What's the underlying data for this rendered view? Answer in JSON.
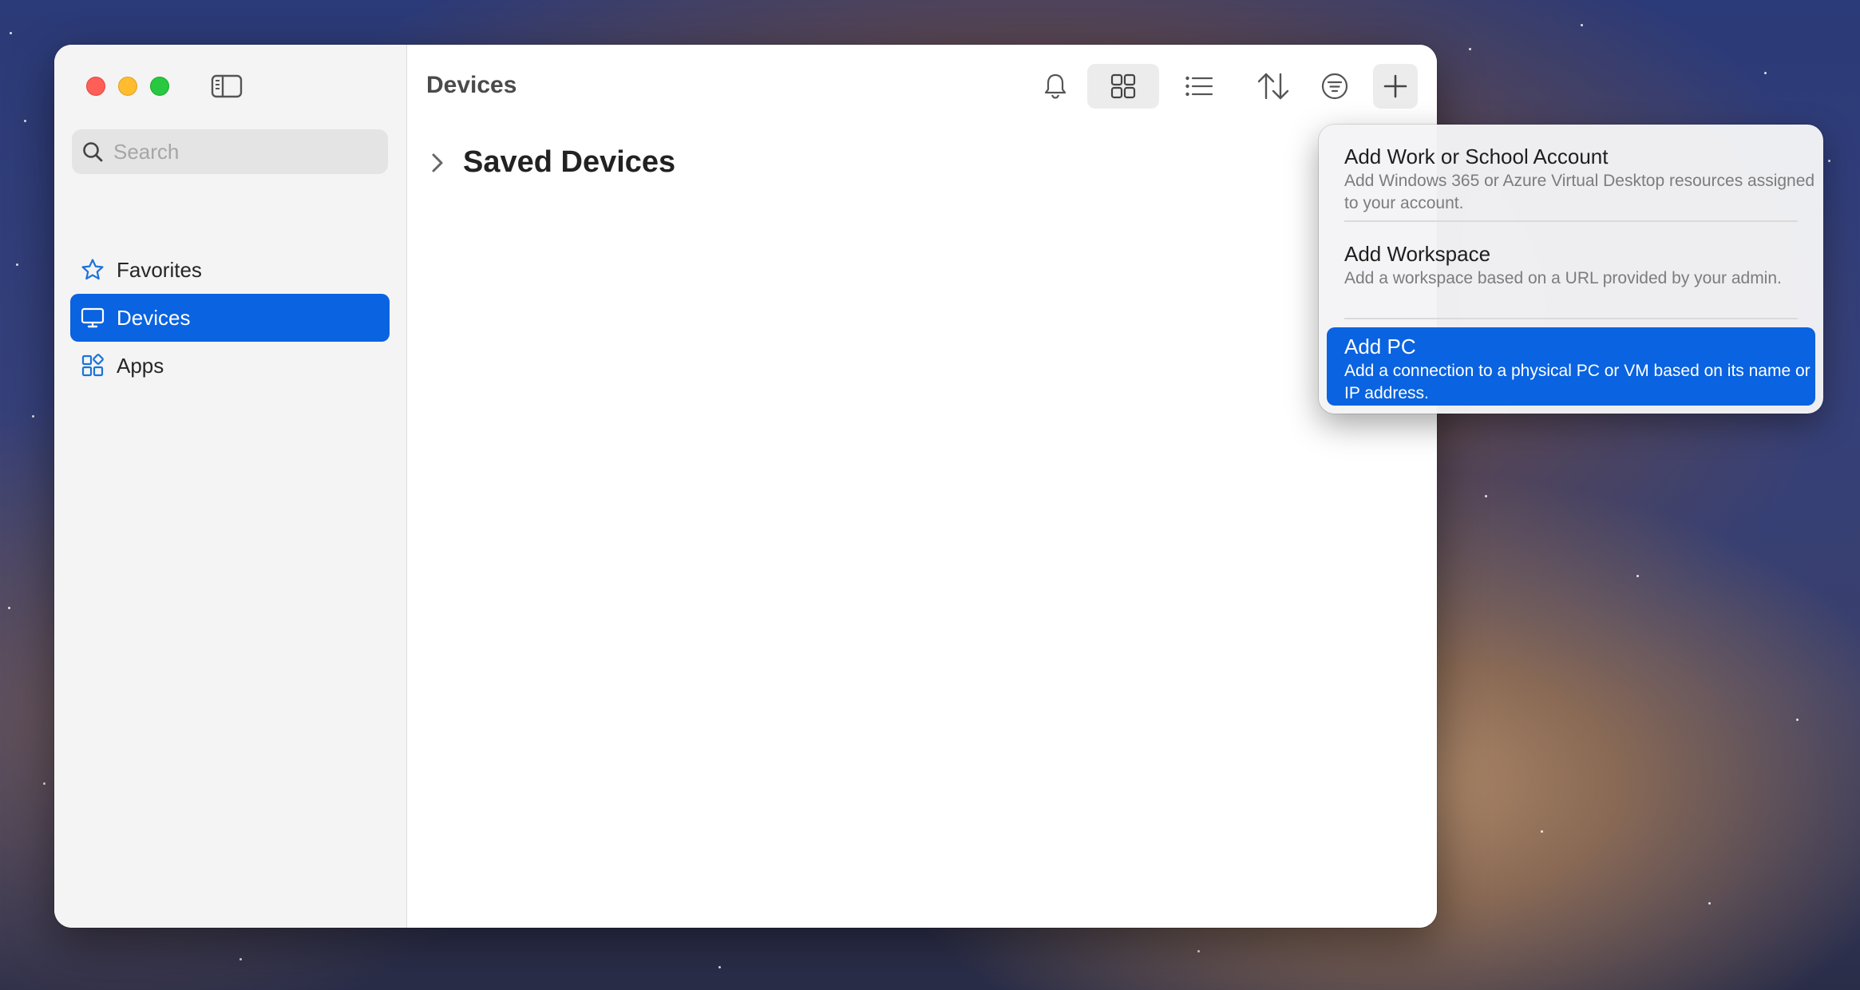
{
  "window": {
    "title": "Devices"
  },
  "sidebar": {
    "search": {
      "placeholder": "Search",
      "value": ""
    },
    "items": [
      {
        "label": "Favorites",
        "icon": "star-icon",
        "active": false
      },
      {
        "label": "Devices",
        "icon": "monitor-icon",
        "active": true
      },
      {
        "label": "Apps",
        "icon": "apps-grid-icon",
        "active": false
      }
    ]
  },
  "toolbar": {
    "buttons": [
      {
        "icon": "bell-icon"
      },
      {
        "icon": "grid-view-icon",
        "selected": true
      },
      {
        "icon": "list-view-icon"
      },
      {
        "icon": "sort-icon"
      },
      {
        "icon": "filter-icon"
      },
      {
        "icon": "plus-icon",
        "selected": true
      },
      {
        "icon": "refresh-icon"
      }
    ]
  },
  "main": {
    "group_title": "Saved Devices"
  },
  "add_menu": {
    "items": [
      {
        "title": "Add Work or School Account",
        "description": "Add Windows 365 or Azure Virtual Desktop resources assigned to your account."
      },
      {
        "title": "Add Workspace",
        "description": "Add a workspace based on a URL provided by your admin."
      },
      {
        "title": "Add PC",
        "description": "Add a connection to a physical PC or VM based on its name or IP address.",
        "highlighted": true
      }
    ]
  },
  "colors": {
    "accent": "#0a63e0",
    "sidebar_bg": "#f4f4f4",
    "close": "#ff5f57",
    "minimize": "#febc2e",
    "zoom": "#28c840"
  }
}
